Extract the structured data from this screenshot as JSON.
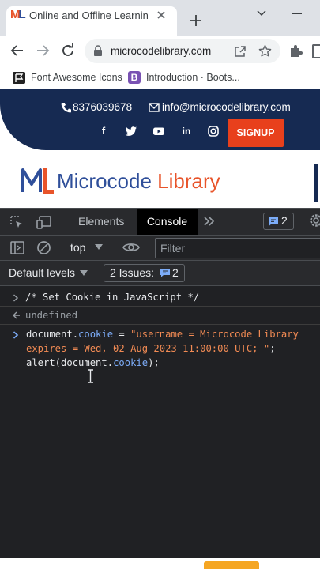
{
  "browser": {
    "tab_title": "Online and Offline Learning P",
    "url": "microcodelibrary.com",
    "bookmarks": [
      {
        "label": "Font Awesome Icons",
        "icon": "font-awesome-flag-icon"
      },
      {
        "label": "Introduction · Boots...",
        "icon": "bootstrap-b-icon"
      }
    ]
  },
  "website": {
    "phone": "8376039678",
    "email": "info@microcodelibrary.com",
    "social_icons": [
      "facebook-icon",
      "twitter-icon",
      "youtube-icon",
      "linkedin-icon",
      "instagram-icon"
    ],
    "signup_label": "SIGNUP",
    "logo_mark": "ML",
    "logo_text_1": "Microcode",
    "logo_text_2": "Library"
  },
  "devtools": {
    "tabs": [
      "Elements",
      "Console"
    ],
    "active_tab": "Console",
    "issues_count": "2",
    "context": "top",
    "filter_placeholder": "Filter",
    "levels_label": "Default levels",
    "issues_label": "2 Issues:",
    "issues_count2": "2"
  },
  "console": {
    "line1": "/* Set Cookie in JavaScript */",
    "line2": "undefined",
    "code": {
      "doc1": "document.",
      "prop1": "cookie",
      "eq": " = ",
      "str1": "\"username = Microcode Library",
      "str2": "expires = Wed, 02 Aug 2023 11:00:00 UTC; \"",
      "semi": ";",
      "alert_pre": "alert(document.",
      "prop2": "cookie",
      "alert_post": ");"
    }
  },
  "colors": {
    "navy": "#162a52",
    "accent_orange": "#e8401c",
    "logo_blue": "#2f4f9a",
    "logo_orange": "#e8542a",
    "console_property": "#7cacf8",
    "console_string": "#f28b54"
  }
}
